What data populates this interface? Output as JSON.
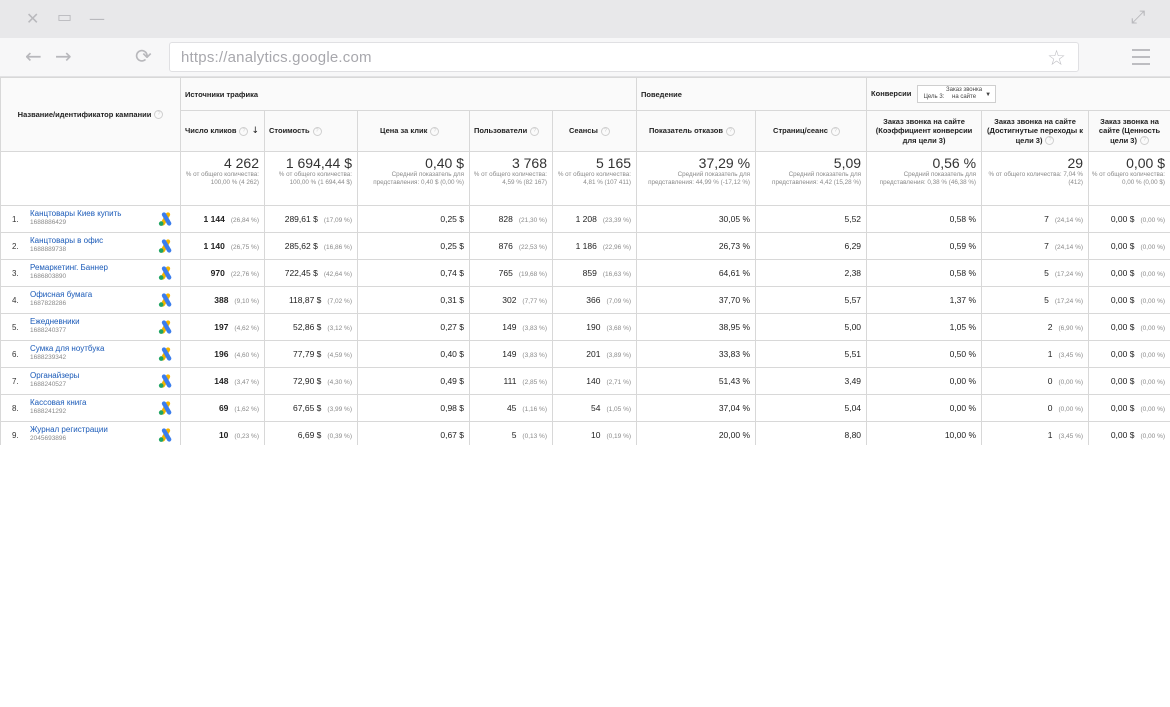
{
  "browser": {
    "url": "https://analytics.google.com"
  },
  "header": {
    "campaign_col": "Название/идентификатор кампании",
    "groups": {
      "traffic": "Источники трафика",
      "behavior": "Поведение",
      "conversions": "Конверсии",
      "goal_prefix": "Цель 3:",
      "goal_line1": "Заказ звонка",
      "goal_line2": "на сайте"
    },
    "cols": {
      "clicks": "Число кликов",
      "cost": "Стоимость",
      "cpc": "Цена за клик",
      "users": "Пользователи",
      "sessions": "Сеансы",
      "bounce": "Показатель отказов",
      "pages": "Страниц/сеанс",
      "conv_rate": "Заказ звонка на сайте (Коэффициент конверсии для цели 3)",
      "completions": "Заказ звонка на сайте (Достигнутые переходы к цели 3)",
      "value": "Заказ звонка на сайте (Ценность цели 3)"
    }
  },
  "totals": {
    "clicks": {
      "value": "4 262",
      "note": "% от общего количества: 100,00 % (4 262)"
    },
    "cost": {
      "value": "1 694,44 $",
      "note": "% от общего количества: 100,00 % (1 694,44 $)"
    },
    "cpc": {
      "value": "0,40 $",
      "note": "Средний показатель для представления: 0,40 $ (0,00 %)"
    },
    "users": {
      "value": "3 768",
      "note": "% от общего количества: 4,59 % (82 167)"
    },
    "sessions": {
      "value": "5 165",
      "note": "% от общего количества: 4,81 % (107 411)"
    },
    "bounce": {
      "value": "37,29 %",
      "note": "Средний показатель для представления: 44,99 % (-17,12 %)"
    },
    "pages": {
      "value": "5,09",
      "note": "Средний показатель для представления: 4,42 (15,28 %)"
    },
    "conv_rate": {
      "value": "0,56 %",
      "note": "Средний показатель для представления: 0,38 % (46,38 %)"
    },
    "completions": {
      "value": "29",
      "note": "% от общего количества: 7,04 % (412)"
    },
    "value": {
      "value": "0,00 $",
      "note": "% от общего количества: 0,00 % (0,00 $)"
    }
  },
  "rows": [
    {
      "idx": "1.",
      "name": "Канцтовары Киев купить",
      "id": "1688886429",
      "clicks": "1 144",
      "clicks_pct": "(26,84 %)",
      "cost": "289,61 $",
      "cost_pct": "(17,09 %)",
      "cpc": "0,25 $",
      "users": "828",
      "users_pct": "(21,30 %)",
      "sessions": "1 208",
      "sessions_pct": "(23,39 %)",
      "bounce": "30,05 %",
      "pages": "5,52",
      "conv_rate": "0,58 %",
      "completions": "7",
      "completions_pct": "(24,14 %)",
      "value": "0,00 $",
      "value_pct": "(0,00 %)"
    },
    {
      "idx": "2.",
      "name": "Канцтовары в офис",
      "id": "1688889738",
      "clicks": "1 140",
      "clicks_pct": "(26,75 %)",
      "cost": "285,62 $",
      "cost_pct": "(16,86 %)",
      "cpc": "0,25 $",
      "users": "876",
      "users_pct": "(22,53 %)",
      "sessions": "1 186",
      "sessions_pct": "(22,96 %)",
      "bounce": "26,73 %",
      "pages": "6,29",
      "conv_rate": "0,59 %",
      "completions": "7",
      "completions_pct": "(24,14 %)",
      "value": "0,00 $",
      "value_pct": "(0,00 %)"
    },
    {
      "idx": "3.",
      "name": "Ремаркетинг. Баннер",
      "id": "1686803890",
      "clicks": "970",
      "clicks_pct": "(22,76 %)",
      "cost": "722,45 $",
      "cost_pct": "(42,64 %)",
      "cpc": "0,74 $",
      "users": "765",
      "users_pct": "(19,68 %)",
      "sessions": "859",
      "sessions_pct": "(16,63 %)",
      "bounce": "64,61 %",
      "pages": "2,38",
      "conv_rate": "0,58 %",
      "completions": "5",
      "completions_pct": "(17,24 %)",
      "value": "0,00 $",
      "value_pct": "(0,00 %)"
    },
    {
      "idx": "4.",
      "name": "Офисная бумага",
      "id": "1687828286",
      "clicks": "388",
      "clicks_pct": "(9,10 %)",
      "cost": "118,87 $",
      "cost_pct": "(7,02 %)",
      "cpc": "0,31 $",
      "users": "302",
      "users_pct": "(7,77 %)",
      "sessions": "366",
      "sessions_pct": "(7,09 %)",
      "bounce": "37,70 %",
      "pages": "5,57",
      "conv_rate": "1,37 %",
      "completions": "5",
      "completions_pct": "(17,24 %)",
      "value": "0,00 $",
      "value_pct": "(0,00 %)"
    },
    {
      "idx": "5.",
      "name": "Ежедневники",
      "id": "1688240377",
      "clicks": "197",
      "clicks_pct": "(4,62 %)",
      "cost": "52,86 $",
      "cost_pct": "(3,12 %)",
      "cpc": "0,27 $",
      "users": "149",
      "users_pct": "(3,83 %)",
      "sessions": "190",
      "sessions_pct": "(3,68 %)",
      "bounce": "38,95 %",
      "pages": "5,00",
      "conv_rate": "1,05 %",
      "completions": "2",
      "completions_pct": "(6,90 %)",
      "value": "0,00 $",
      "value_pct": "(0,00 %)"
    },
    {
      "idx": "6.",
      "name": "Сумка для ноутбука",
      "id": "1688239342",
      "clicks": "196",
      "clicks_pct": "(4,60 %)",
      "cost": "77,79 $",
      "cost_pct": "(4,59 %)",
      "cpc": "0,40 $",
      "users": "149",
      "users_pct": "(3,83 %)",
      "sessions": "201",
      "sessions_pct": "(3,89 %)",
      "bounce": "33,83 %",
      "pages": "5,51",
      "conv_rate": "0,50 %",
      "completions": "1",
      "completions_pct": "(3,45 %)",
      "value": "0,00 $",
      "value_pct": "(0,00 %)"
    },
    {
      "idx": "7.",
      "name": "Органайзеры",
      "id": "1688240527",
      "clicks": "148",
      "clicks_pct": "(3,47 %)",
      "cost": "72,90 $",
      "cost_pct": "(4,30 %)",
      "cpc": "0,49 $",
      "users": "111",
      "users_pct": "(2,85 %)",
      "sessions": "140",
      "sessions_pct": "(2,71 %)",
      "bounce": "51,43 %",
      "pages": "3,49",
      "conv_rate": "0,00 %",
      "completions": "0",
      "completions_pct": "(0,00 %)",
      "value": "0,00 $",
      "value_pct": "(0,00 %)"
    },
    {
      "idx": "8.",
      "name": "Кассовая книга",
      "id": "1688241292",
      "clicks": "69",
      "clicks_pct": "(1,62 %)",
      "cost": "67,65 $",
      "cost_pct": "(3,99 %)",
      "cpc": "0,98 $",
      "users": "45",
      "users_pct": "(1,16 %)",
      "sessions": "54",
      "sessions_pct": "(1,05 %)",
      "bounce": "37,04 %",
      "pages": "5,04",
      "conv_rate": "0,00 %",
      "completions": "0",
      "completions_pct": "(0,00 %)",
      "value": "0,00 $",
      "value_pct": "(0,00 %)"
    },
    {
      "idx": "9.",
      "name": "Журнал регистрации",
      "id": "2045693896",
      "clicks": "10",
      "clicks_pct": "(0,23 %)",
      "cost": "6,69 $",
      "cost_pct": "(0,39 %)",
      "cpc": "0,67 $",
      "users": "5",
      "users_pct": "(0,13 %)",
      "sessions": "10",
      "sessions_pct": "(0,19 %)",
      "bounce": "20,00 %",
      "pages": "8,80",
      "conv_rate": "10,00 %",
      "completions": "1",
      "completions_pct": "(3,45 %)",
      "value": "0,00 $",
      "value_pct": "(0,00 %)"
    }
  ],
  "colors": {
    "link": "#1a5ab8",
    "ads_blue": "#3b7ded",
    "ads_yellow": "#f5b400",
    "ads_green": "#1fa463"
  }
}
